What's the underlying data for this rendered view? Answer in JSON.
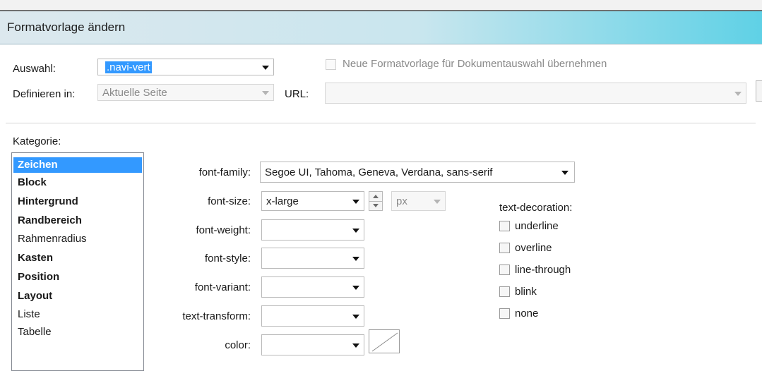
{
  "window": {
    "title": "Formatvorlage ändern"
  },
  "auswahl": {
    "label": "Auswahl:",
    "value": ".navi-vert"
  },
  "neue_formatvorlage": {
    "label": "Neue Formatvorlage für Dokumentauswahl übernehmen",
    "checked": false,
    "enabled": false
  },
  "definieren": {
    "label": "Definieren in:",
    "value": "Aktuelle Seite"
  },
  "url": {
    "label": "URL:",
    "value": ""
  },
  "kategorie": {
    "label": "Kategorie:",
    "items": [
      {
        "label": "Zeichen",
        "bold": true,
        "selected": true
      },
      {
        "label": "Block",
        "bold": true,
        "selected": false
      },
      {
        "label": "Hintergrund",
        "bold": true,
        "selected": false
      },
      {
        "label": "Randbereich",
        "bold": true,
        "selected": false
      },
      {
        "label": "Rahmenradius",
        "bold": false,
        "selected": false
      },
      {
        "label": "Kasten",
        "bold": true,
        "selected": false
      },
      {
        "label": "Position",
        "bold": true,
        "selected": false
      },
      {
        "label": "Layout",
        "bold": true,
        "selected": false
      },
      {
        "label": "Liste",
        "bold": false,
        "selected": false
      },
      {
        "label": "Tabelle",
        "bold": false,
        "selected": false
      }
    ]
  },
  "props": {
    "font_family": {
      "label": "font-family:",
      "value": "Segoe UI, Tahoma, Geneva, Verdana, sans-serif"
    },
    "font_size": {
      "label": "font-size:",
      "value": "x-large",
      "unit": "px"
    },
    "font_weight": {
      "label": "font-weight:",
      "value": ""
    },
    "font_style": {
      "label": "font-style:",
      "value": ""
    },
    "font_variant": {
      "label": "font-variant:",
      "value": ""
    },
    "text_transform": {
      "label": "text-transform:",
      "value": ""
    },
    "color": {
      "label": "color:",
      "value": ""
    }
  },
  "text_decoration": {
    "label": "text-decoration:",
    "options": [
      {
        "label": "underline",
        "checked": false
      },
      {
        "label": "overline",
        "checked": false
      },
      {
        "label": "line-through",
        "checked": false
      },
      {
        "label": "blink",
        "checked": false
      },
      {
        "label": "none",
        "checked": false
      }
    ]
  }
}
